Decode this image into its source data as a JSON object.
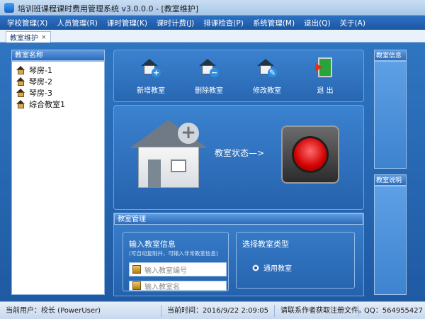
{
  "window": {
    "title": "培训班课程课时费用管理系统   v3.0.0.0 - [教室维护]"
  },
  "menu": [
    "学校管理(X)",
    "人员管理(R)",
    "课时管理(K)",
    "课时计费(J)",
    "排课检查(P)",
    "系统管理(M)",
    "退出(Q)",
    "关于(A)"
  ],
  "tab": {
    "label": "教室维护",
    "close": "×"
  },
  "left_panel": {
    "title": "教室名称",
    "items": [
      "琴房-1",
      "琴房-2",
      "琴房-3",
      "综合教室1"
    ]
  },
  "toolbar": {
    "add": "新增教室",
    "delete": "删除教室",
    "edit": "修改教室",
    "exit": "退   出"
  },
  "status": {
    "label": "教室状态—>"
  },
  "manage": {
    "title": "教室管理",
    "input_group_title": "输入教室信息",
    "input_hint": "(可自动复制并，可输入非常教室信息)",
    "field_1_placeholder": "输入教室编号",
    "field_2_placeholder": "输入教室名",
    "type_group_title": "选择教室类型",
    "type_option": "通用教室"
  },
  "right_panels": {
    "info_title": "教室信息",
    "desc_title": "教室说明"
  },
  "statusbar": {
    "user": "当前用户：校长 (PowerUser)",
    "time": "当前时间：2016/9/22 2:09:05",
    "contact": "请联系作者获取注册文件。",
    "qq": "QQ：564955427"
  },
  "colors": {
    "accent": "#2c6fb8",
    "indicator": "#d10000"
  }
}
